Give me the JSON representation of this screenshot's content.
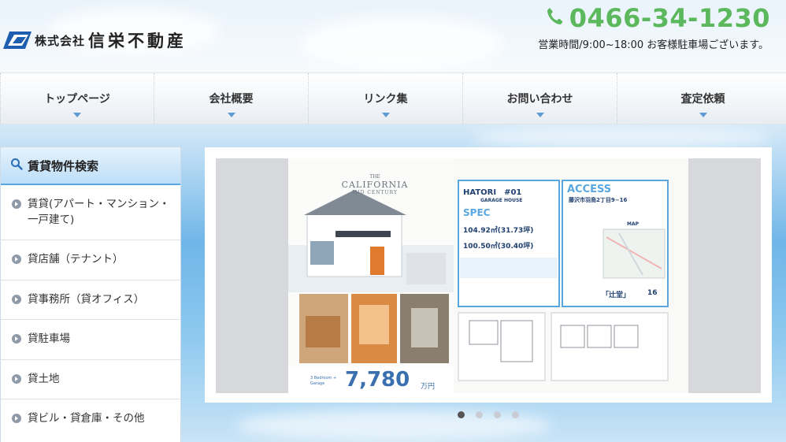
{
  "header": {
    "logo_small": "株式会社",
    "logo_big": "信栄不動産",
    "phone": "0466-34-1230",
    "hours": "営業時間/9:00~18:00 お客様駐車場ございます。"
  },
  "nav": {
    "items": [
      {
        "label": "トップページ"
      },
      {
        "label": "会社概要"
      },
      {
        "label": "リンク集"
      },
      {
        "label": "お問い合わせ"
      },
      {
        "label": "査定依頼"
      }
    ]
  },
  "sidebar": {
    "title": "賃貸物件検索",
    "items": [
      {
        "label": "賃貸(アパート・マンション・一戸建て)"
      },
      {
        "label": "貸店舗（テナント）"
      },
      {
        "label": "貸事務所（貸オフィス）"
      },
      {
        "label": "貸駐車場"
      },
      {
        "label": "貸土地"
      },
      {
        "label": "貸ビル・貸倉庫・その他"
      }
    ]
  },
  "slide": {
    "flyer": {
      "the": "THE",
      "california": "CALIFORNIA",
      "mid_century": "MID CENTURY",
      "hatori": "HATORI　#01",
      "garage_house": "GARAGE HOUSE",
      "spec": "SPEC",
      "land_area": "104.92㎡(31.73坪)",
      "floor_area": "100.50㎡(30.40坪)",
      "access": "ACCESS",
      "address": "藤沢市羽鳥2丁目9−16",
      "map": "MAP",
      "plan": "3 Bedroom + Garage",
      "price": "7,780",
      "price_unit": "万円",
      "station": "「辻堂」",
      "walk": "16"
    },
    "active_index": 0,
    "total": 4
  },
  "colors": {
    "accent": "#5aa7e0",
    "phone": "#5cb85c",
    "price": "#3a6fb0"
  }
}
